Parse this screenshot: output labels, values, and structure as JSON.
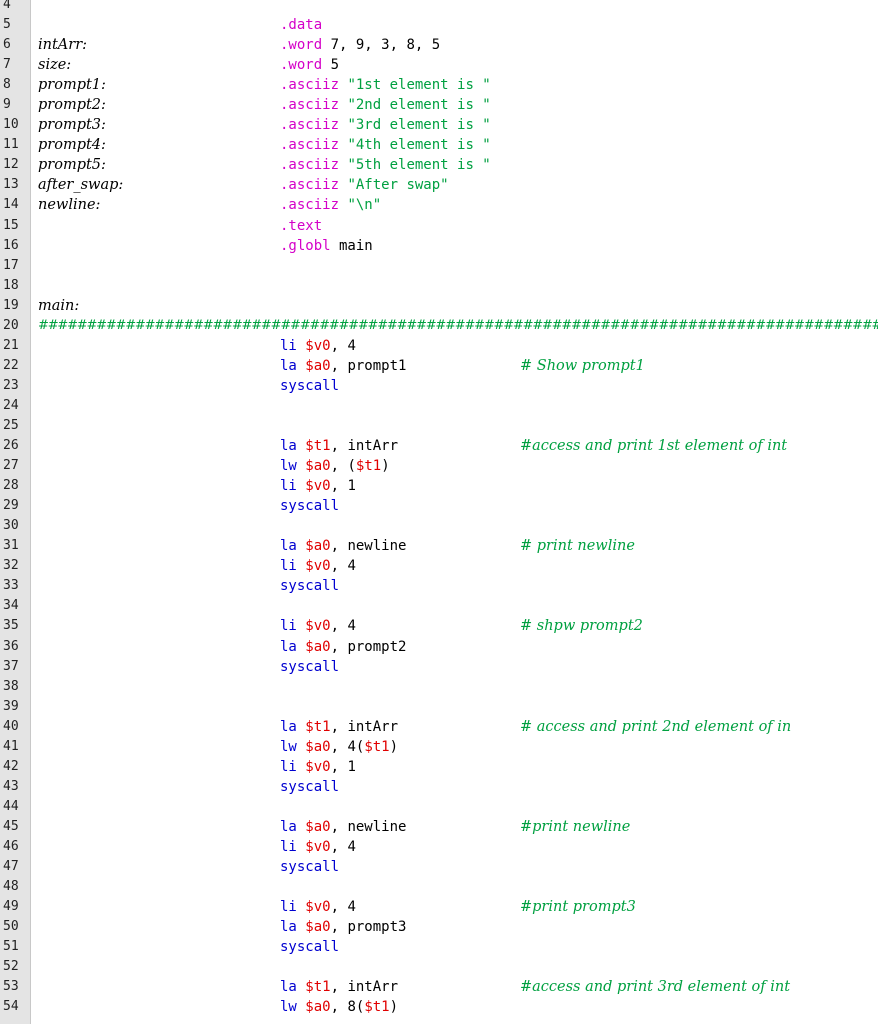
{
  "editor": {
    "colors": {
      "directive": "#d400c8",
      "string": "#00a040",
      "instruction": "#0000d0",
      "register": "#e00000",
      "comment": "#00a040",
      "gutter": "#e4e4e4"
    },
    "lines": [
      {
        "n": "4",
        "tokens": []
      },
      {
        "n": "5",
        "tokens": [
          {
            "t": ".data",
            "c": "d"
          }
        ]
      },
      {
        "n": "6",
        "label": "intArr:",
        "tokens": [
          {
            "t": ".word",
            "c": "d"
          },
          {
            "t": " 7, 9, 3, 8, 5",
            "c": "p"
          }
        ]
      },
      {
        "n": "7",
        "label": "size:",
        "tokens": [
          {
            "t": ".word",
            "c": "d"
          },
          {
            "t": " 5",
            "c": "p"
          }
        ]
      },
      {
        "n": "8",
        "label": "prompt1:",
        "tokens": [
          {
            "t": ".asciiz",
            "c": "d"
          },
          {
            "t": " \"1st element is \"",
            "c": "s"
          }
        ]
      },
      {
        "n": "9",
        "label": "prompt2:",
        "tokens": [
          {
            "t": ".asciiz",
            "c": "d"
          },
          {
            "t": " \"2nd element is \"",
            "c": "s"
          }
        ]
      },
      {
        "n": "10",
        "label": "prompt3:",
        "tokens": [
          {
            "t": ".asciiz",
            "c": "d"
          },
          {
            "t": " \"3rd element is \"",
            "c": "s"
          }
        ]
      },
      {
        "n": "11",
        "label": "prompt4:",
        "tokens": [
          {
            "t": ".asciiz",
            "c": "d"
          },
          {
            "t": " \"4th element is \"",
            "c": "s"
          }
        ]
      },
      {
        "n": "12",
        "label": "prompt5:",
        "tokens": [
          {
            "t": ".asciiz",
            "c": "d"
          },
          {
            "t": " \"5th element is \"",
            "c": "s"
          }
        ]
      },
      {
        "n": "13",
        "label": "after_swap:",
        "tokens": [
          {
            "t": ".asciiz",
            "c": "d"
          },
          {
            "t": " \"After swap\"",
            "c": "s"
          }
        ]
      },
      {
        "n": "14",
        "label": "newline:",
        "tokens": [
          {
            "t": ".asciiz",
            "c": "d"
          },
          {
            "t": " \"\\n\"",
            "c": "s"
          }
        ]
      },
      {
        "n": "15",
        "tokens": [
          {
            "t": ".text",
            "c": "d"
          }
        ]
      },
      {
        "n": "16",
        "tokens": [
          {
            "t": ".globl",
            "c": "d"
          },
          {
            "t": " main",
            "c": "p"
          }
        ]
      },
      {
        "n": "17",
        "tokens": []
      },
      {
        "n": "18",
        "tokens": []
      },
      {
        "n": "19",
        "label": "main:",
        "tokens": []
      },
      {
        "n": "20",
        "hashes": "##################################################################################################",
        "tokens": []
      },
      {
        "n": "21",
        "tokens": [
          {
            "t": "li",
            "c": "i"
          },
          {
            "t": " ",
            "c": "p"
          },
          {
            "t": "$v0",
            "c": "r"
          },
          {
            "t": ", 4",
            "c": "p"
          }
        ]
      },
      {
        "n": "22",
        "tokens": [
          {
            "t": "la",
            "c": "i"
          },
          {
            "t": " ",
            "c": "p"
          },
          {
            "t": "$a0",
            "c": "r"
          },
          {
            "t": ", prompt1",
            "c": "p"
          }
        ],
        "comment": "# Show prompt1"
      },
      {
        "n": "23",
        "tokens": [
          {
            "t": "syscall",
            "c": "i"
          }
        ]
      },
      {
        "n": "24",
        "tokens": []
      },
      {
        "n": "25",
        "tokens": []
      },
      {
        "n": "26",
        "tokens": [
          {
            "t": "la",
            "c": "i"
          },
          {
            "t": " ",
            "c": "p"
          },
          {
            "t": "$t1",
            "c": "r"
          },
          {
            "t": ", intArr",
            "c": "p"
          }
        ],
        "comment": "#access and print 1st element of int"
      },
      {
        "n": "27",
        "tokens": [
          {
            "t": "lw",
            "c": "i"
          },
          {
            "t": " ",
            "c": "p"
          },
          {
            "t": "$a0",
            "c": "r"
          },
          {
            "t": ", (",
            "c": "p"
          },
          {
            "t": "$t1",
            "c": "r"
          },
          {
            "t": ")",
            "c": "p"
          }
        ]
      },
      {
        "n": "28",
        "tokens": [
          {
            "t": "li",
            "c": "i"
          },
          {
            "t": " ",
            "c": "p"
          },
          {
            "t": "$v0",
            "c": "r"
          },
          {
            "t": ", 1",
            "c": "p"
          }
        ]
      },
      {
        "n": "29",
        "tokens": [
          {
            "t": "syscall",
            "c": "i"
          }
        ]
      },
      {
        "n": "30",
        "tokens": []
      },
      {
        "n": "31",
        "tokens": [
          {
            "t": "la",
            "c": "i"
          },
          {
            "t": " ",
            "c": "p"
          },
          {
            "t": "$a0",
            "c": "r"
          },
          {
            "t": ", newline",
            "c": "p"
          }
        ],
        "comment": "# print newline"
      },
      {
        "n": "32",
        "tokens": [
          {
            "t": "li",
            "c": "i"
          },
          {
            "t": " ",
            "c": "p"
          },
          {
            "t": "$v0",
            "c": "r"
          },
          {
            "t": ", 4",
            "c": "p"
          }
        ]
      },
      {
        "n": "33",
        "tokens": [
          {
            "t": "syscall",
            "c": "i"
          }
        ]
      },
      {
        "n": "34",
        "tokens": []
      },
      {
        "n": "35",
        "tokens": [
          {
            "t": "li",
            "c": "i"
          },
          {
            "t": " ",
            "c": "p"
          },
          {
            "t": "$v0",
            "c": "r"
          },
          {
            "t": ", 4",
            "c": "p"
          }
        ],
        "comment": "# shpw prompt2"
      },
      {
        "n": "36",
        "tokens": [
          {
            "t": "la",
            "c": "i"
          },
          {
            "t": " ",
            "c": "p"
          },
          {
            "t": "$a0",
            "c": "r"
          },
          {
            "t": ", prompt2",
            "c": "p"
          }
        ]
      },
      {
        "n": "37",
        "tokens": [
          {
            "t": "syscall",
            "c": "i"
          }
        ]
      },
      {
        "n": "38",
        "tokens": []
      },
      {
        "n": "39",
        "tokens": []
      },
      {
        "n": "40",
        "tokens": [
          {
            "t": "la",
            "c": "i"
          },
          {
            "t": " ",
            "c": "p"
          },
          {
            "t": "$t1",
            "c": "r"
          },
          {
            "t": ", intArr",
            "c": "p"
          }
        ],
        "comment": "# access and print 2nd element of in"
      },
      {
        "n": "41",
        "tokens": [
          {
            "t": "lw",
            "c": "i"
          },
          {
            "t": " ",
            "c": "p"
          },
          {
            "t": "$a0",
            "c": "r"
          },
          {
            "t": ", 4(",
            "c": "p"
          },
          {
            "t": "$t1",
            "c": "r"
          },
          {
            "t": ")",
            "c": "p"
          }
        ]
      },
      {
        "n": "42",
        "tokens": [
          {
            "t": "li",
            "c": "i"
          },
          {
            "t": " ",
            "c": "p"
          },
          {
            "t": "$v0",
            "c": "r"
          },
          {
            "t": ", 1",
            "c": "p"
          }
        ]
      },
      {
        "n": "43",
        "tokens": [
          {
            "t": "syscall",
            "c": "i"
          }
        ]
      },
      {
        "n": "44",
        "tokens": []
      },
      {
        "n": "45",
        "tokens": [
          {
            "t": "la",
            "c": "i"
          },
          {
            "t": " ",
            "c": "p"
          },
          {
            "t": "$a0",
            "c": "r"
          },
          {
            "t": ", newline",
            "c": "p"
          }
        ],
        "comment": "#print newline"
      },
      {
        "n": "46",
        "tokens": [
          {
            "t": "li",
            "c": "i"
          },
          {
            "t": " ",
            "c": "p"
          },
          {
            "t": "$v0",
            "c": "r"
          },
          {
            "t": ", 4",
            "c": "p"
          }
        ]
      },
      {
        "n": "47",
        "tokens": [
          {
            "t": "syscall",
            "c": "i"
          }
        ]
      },
      {
        "n": "48",
        "tokens": []
      },
      {
        "n": "49",
        "tokens": [
          {
            "t": "li",
            "c": "i"
          },
          {
            "t": " ",
            "c": "p"
          },
          {
            "t": "$v0",
            "c": "r"
          },
          {
            "t": ", 4",
            "c": "p"
          }
        ],
        "comment": "#print prompt3"
      },
      {
        "n": "50",
        "tokens": [
          {
            "t": "la",
            "c": "i"
          },
          {
            "t": " ",
            "c": "p"
          },
          {
            "t": "$a0",
            "c": "r"
          },
          {
            "t": ", prompt3",
            "c": "p"
          }
        ]
      },
      {
        "n": "51",
        "tokens": [
          {
            "t": "syscall",
            "c": "i"
          }
        ]
      },
      {
        "n": "52",
        "tokens": []
      },
      {
        "n": "53",
        "tokens": [
          {
            "t": "la",
            "c": "i"
          },
          {
            "t": " ",
            "c": "p"
          },
          {
            "t": "$t1",
            "c": "r"
          },
          {
            "t": ", intArr",
            "c": "p"
          }
        ],
        "comment": "#access and print 3rd element of int"
      },
      {
        "n": "54",
        "tokens": [
          {
            "t": "lw",
            "c": "i"
          },
          {
            "t": " ",
            "c": "p"
          },
          {
            "t": "$a0",
            "c": "r"
          },
          {
            "t": ", 8(",
            "c": "p"
          },
          {
            "t": "$t1",
            "c": "r"
          },
          {
            "t": ")",
            "c": "p"
          }
        ]
      }
    ]
  }
}
